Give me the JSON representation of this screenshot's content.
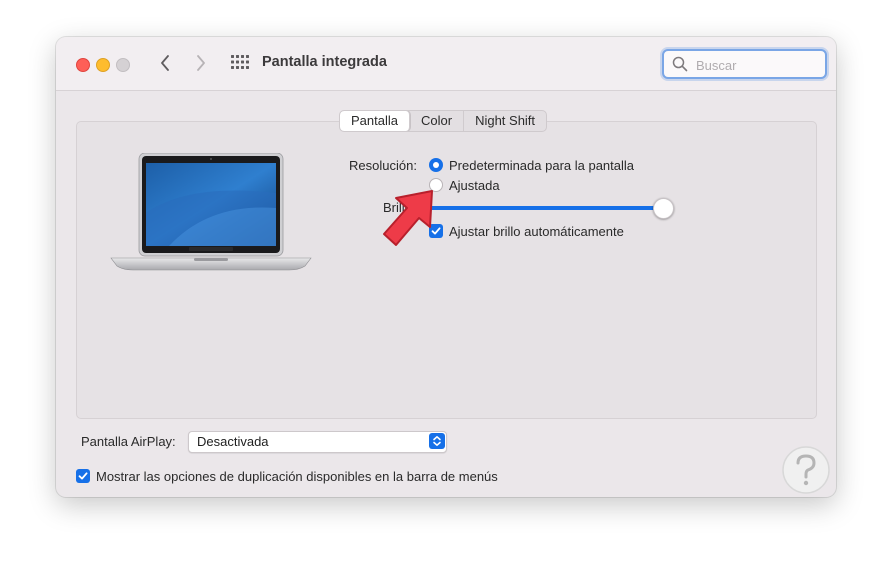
{
  "window": {
    "title": "Pantalla integrada"
  },
  "search": {
    "placeholder": "Buscar",
    "value": ""
  },
  "tabs": [
    {
      "label": "Pantalla",
      "selected": true
    },
    {
      "label": "Color",
      "selected": false
    },
    {
      "label": "Night Shift",
      "selected": false
    }
  ],
  "display": {
    "resolution_label": "Resolución:",
    "options": [
      {
        "label": "Predeterminada para la pantalla",
        "selected": true
      },
      {
        "label": "Ajustada",
        "selected": false
      }
    ],
    "brightness_label": "Brillo:",
    "brightness_value": 1.0,
    "auto_brightness_label": "Ajustar brillo automáticamente",
    "auto_brightness_checked": true
  },
  "airplay": {
    "label": "Pantalla AirPlay:",
    "value": "Desactivada"
  },
  "mirroring": {
    "label": "Mostrar las opciones de duplicación disponibles en la barra de menús",
    "checked": true
  },
  "icons": {
    "back": "chevron-left-icon",
    "forward": "chevron-right-icon",
    "grid": "grid-icon",
    "search": "magnifying-glass-icon",
    "pointer": "arrow-pointer-icon",
    "laptop": "laptop-icon",
    "watermark": "site-watermark-icon"
  },
  "colors": {
    "accent": "#1670e8",
    "arrow": "#ee3b48"
  }
}
